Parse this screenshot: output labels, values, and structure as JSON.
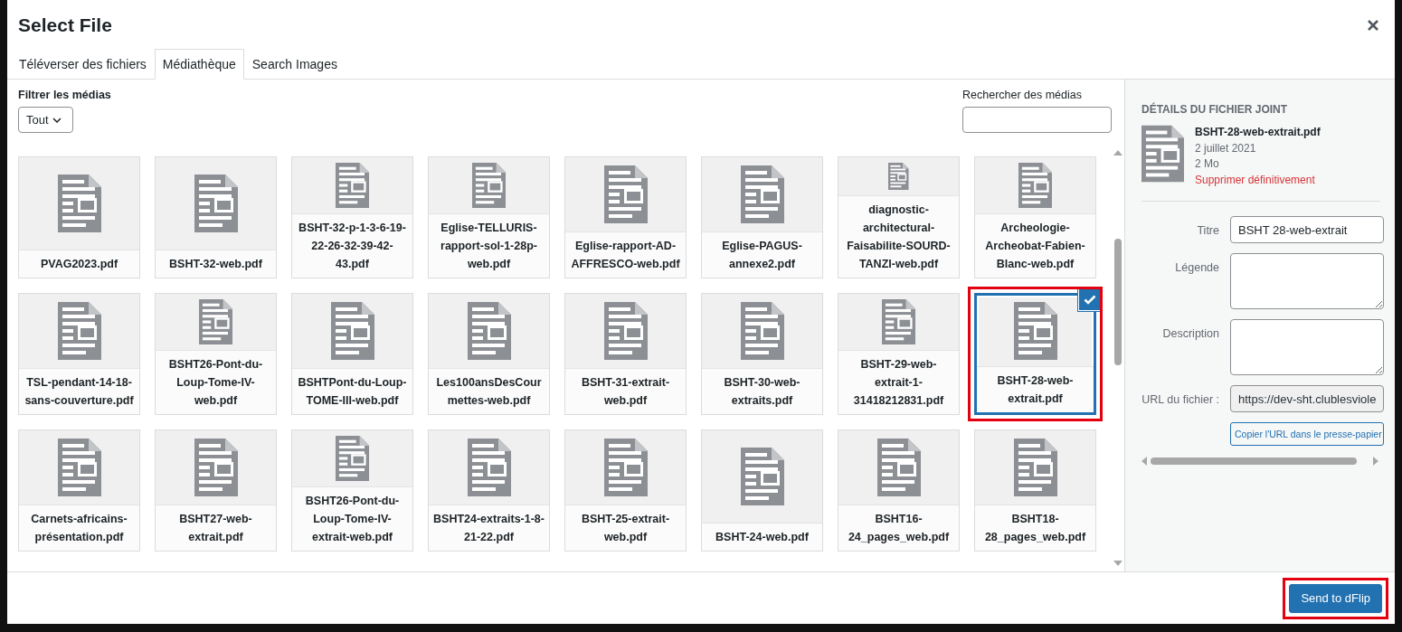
{
  "dialog": {
    "title": "Select File"
  },
  "tabs": [
    {
      "label": "Téléverser des fichiers",
      "selected": false
    },
    {
      "label": "Médiathèque",
      "selected": true
    },
    {
      "label": "Search Images",
      "selected": false
    }
  ],
  "filter": {
    "label": "Filtrer les médias",
    "value": "Tout"
  },
  "search": {
    "label": "Rechercher des médias"
  },
  "attachments": [
    {
      "filename": "PVAG2023.pdf",
      "selected": false,
      "highlighted": false
    },
    {
      "filename": "BSHT-32-web.pdf",
      "selected": false,
      "highlighted": false
    },
    {
      "filename": "BSHT-32-p-1-3-6-19-22-26-32-39-42-43.pdf",
      "selected": false,
      "highlighted": false
    },
    {
      "filename": "Eglise-TELLURIS-rapport-sol-1-28p-web.pdf",
      "selected": false,
      "highlighted": false
    },
    {
      "filename": "Eglise-rapport-AD-AFFRESCO-web.pdf",
      "selected": false,
      "highlighted": false
    },
    {
      "filename": "Eglise-PAGUS-annexe2.pdf",
      "selected": false,
      "highlighted": false
    },
    {
      "filename": "diagnostic-architectural-Faisabilite-SOURD-TANZI-web.pdf",
      "selected": false,
      "highlighted": false
    },
    {
      "filename": "Archeologie-Archeobat-Fabien-Blanc-web.pdf",
      "selected": false,
      "highlighted": false
    },
    {
      "filename": "TSL-pendant-14-18-sans-couverture.pdf",
      "selected": false,
      "highlighted": false
    },
    {
      "filename": "BSHT26-Pont-du-Loup-Tome-IV-web.pdf",
      "selected": false,
      "highlighted": false
    },
    {
      "filename": "BSHTPont-du-Loup-TOME-III-web.pdf",
      "selected": false,
      "highlighted": false
    },
    {
      "filename": "Les100ansDesCourmettes-web.pdf",
      "selected": false,
      "highlighted": false
    },
    {
      "filename": "BSHT-31-extrait-web.pdf",
      "selected": false,
      "highlighted": false
    },
    {
      "filename": "BSHT-30-web-extraits.pdf",
      "selected": false,
      "highlighted": false
    },
    {
      "filename": "BSHT-29-web-extrait-1-31418212831.pdf",
      "selected": false,
      "highlighted": false
    },
    {
      "filename": "BSHT-28-web-extrait.pdf",
      "selected": true,
      "highlighted": true
    },
    {
      "filename": "Carnets-africains-présentation.pdf",
      "selected": false,
      "highlighted": false
    },
    {
      "filename": "BSHT27-web-extrait.pdf",
      "selected": false,
      "highlighted": false
    },
    {
      "filename": "BSHT26-Pont-du-Loup-Tome-IV-extrait-web.pdf",
      "selected": false,
      "highlighted": false
    },
    {
      "filename": "BSHT24-extraits-1-8-21-22.pdf",
      "selected": false,
      "highlighted": false
    },
    {
      "filename": "BSHT-25-extrait-web.pdf",
      "selected": false,
      "highlighted": false
    },
    {
      "filename": "BSHT-24-web.pdf",
      "selected": false,
      "highlighted": false
    },
    {
      "filename": "BSHT16-24_pages_web.pdf",
      "selected": false,
      "highlighted": false
    },
    {
      "filename": "BSHT18-28_pages_web.pdf",
      "selected": false,
      "highlighted": false
    }
  ],
  "details": {
    "heading": "DÉTAILS DU FICHIER JOINT",
    "filename": "BSHT-28-web-extrait.pdf",
    "date": "2 juillet 2021",
    "size": "2 Mo",
    "delete_link": "Supprimer définitivement",
    "fields": [
      {
        "kind": "input",
        "label": "Titre",
        "value": "BSHT 28-web-extrait"
      },
      {
        "kind": "textarea",
        "label": "Légende"
      },
      {
        "kind": "textarea",
        "label": "Description"
      },
      {
        "kind": "readonly",
        "label": "URL du fichier :",
        "value": "https://dev-sht.clublesviole"
      }
    ],
    "copy_button": "Copier l'URL dans le presse-papier"
  },
  "footer": {
    "button": {
      "label": "Send to dFlip",
      "highlighted": true
    }
  }
}
